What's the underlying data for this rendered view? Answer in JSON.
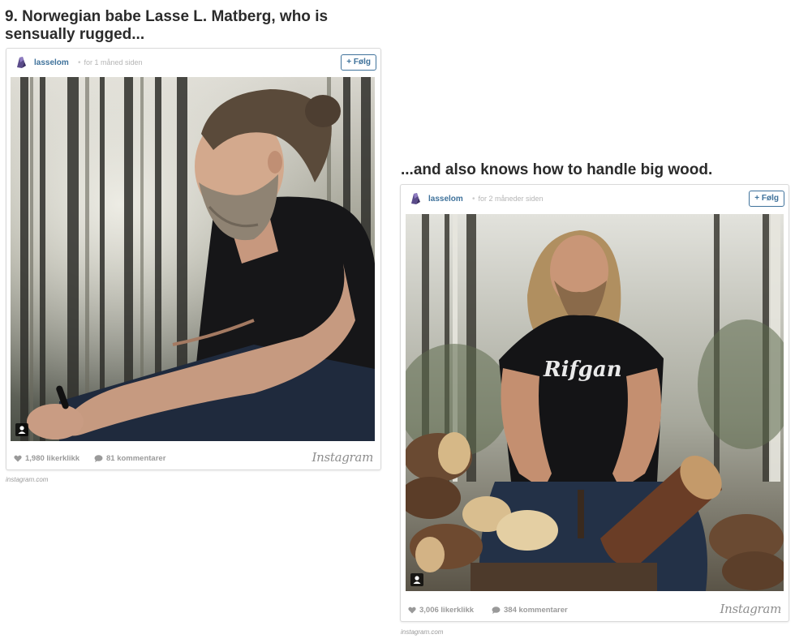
{
  "article": {
    "heading1": "9. Norwegian babe Lasse L. Matberg, who is sensually rugged...",
    "heading2": "...and also knows how to handle big wood."
  },
  "posts": [
    {
      "username": "lasselom",
      "time_ago": "for 1 måned siden",
      "follow_label": "+ Følg",
      "likes": "1,980 likerklikk",
      "comments": "81 kommentarer",
      "brand": "Instagram",
      "source": "instagram.com",
      "photo_icon": "user-tag-icon"
    },
    {
      "username": "lasselom",
      "time_ago": "for 2 måneder siden",
      "follow_label": "+ Følg",
      "likes": "3,006 likerklikk",
      "comments": "384 kommentarer",
      "brand": "Instagram",
      "source": "instagram.com",
      "photo_icon": "user-tag-icon"
    }
  ],
  "colors": {
    "link_blue": "#3f729b",
    "muted_gray": "#9a9a9a",
    "heading": "#2b2b2b"
  }
}
